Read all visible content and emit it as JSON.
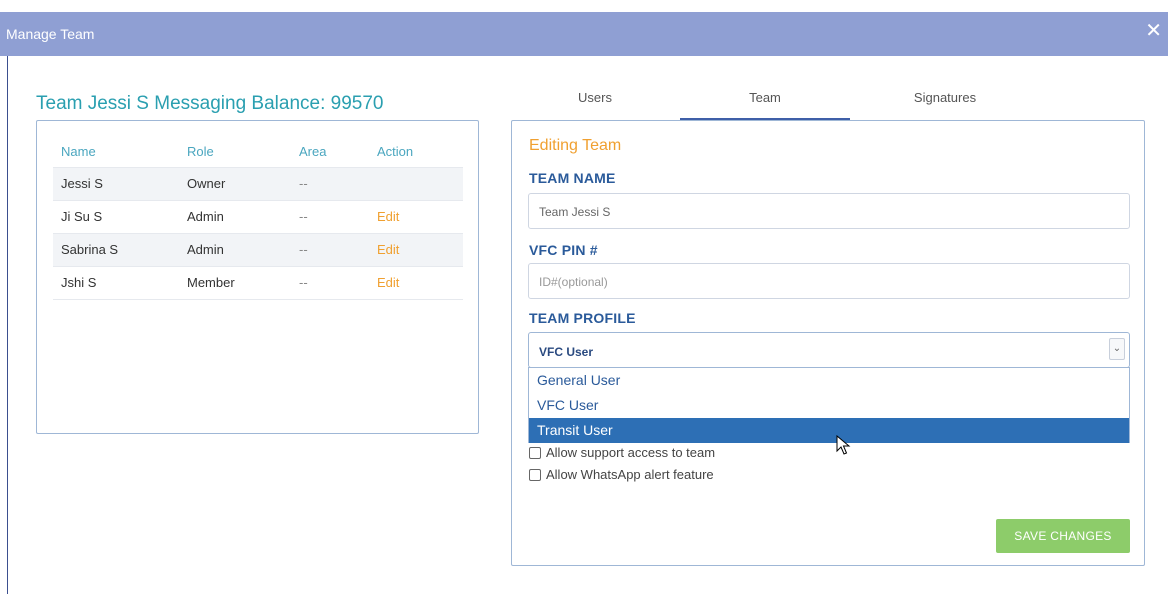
{
  "window": {
    "title": "Manage Team",
    "close_glyph": "✕"
  },
  "balance": {
    "text": "Team Jessi S Messaging Balance: 99570"
  },
  "members": {
    "headers": [
      "Name",
      "Role",
      "Area",
      "Action"
    ],
    "rows": [
      {
        "name": "Jessi S",
        "role": "Owner",
        "area": "--",
        "action": ""
      },
      {
        "name": "Ji Su S",
        "role": "Admin",
        "area": "--",
        "action": "Edit"
      },
      {
        "name": "Sabrina S",
        "role": "Admin",
        "area": "--",
        "action": "Edit"
      },
      {
        "name": "Jshi S",
        "role": "Member",
        "area": "--",
        "action": "Edit"
      }
    ]
  },
  "tabs": {
    "users": "Users",
    "team": "Team",
    "signatures": "Signatures",
    "active": "Team"
  },
  "form": {
    "heading": "Editing Team",
    "team_name_label": "TEAM NAME",
    "team_name_value": "Team Jessi S",
    "pin_label": "VFC PIN #",
    "pin_placeholder": "ID#(optional)",
    "profile_label": "TEAM PROFILE",
    "profile_selected": "VFC User",
    "profile_options": [
      "General User",
      "VFC User",
      "Transit User"
    ],
    "profile_highlighted": "Transit User",
    "checkbox_support": "Allow support access to team",
    "checkbox_whatsapp": "Allow WhatsApp alert feature",
    "save_label": "SAVE CHANGES"
  },
  "colors": {
    "titlebar": "#8f9fd3",
    "accent_teal": "#2a9fb0",
    "accent_orange": "#f0a030",
    "label_blue": "#2a5a9a",
    "highlight": "#2d6fb5",
    "save_green": "#8dcc6a"
  }
}
